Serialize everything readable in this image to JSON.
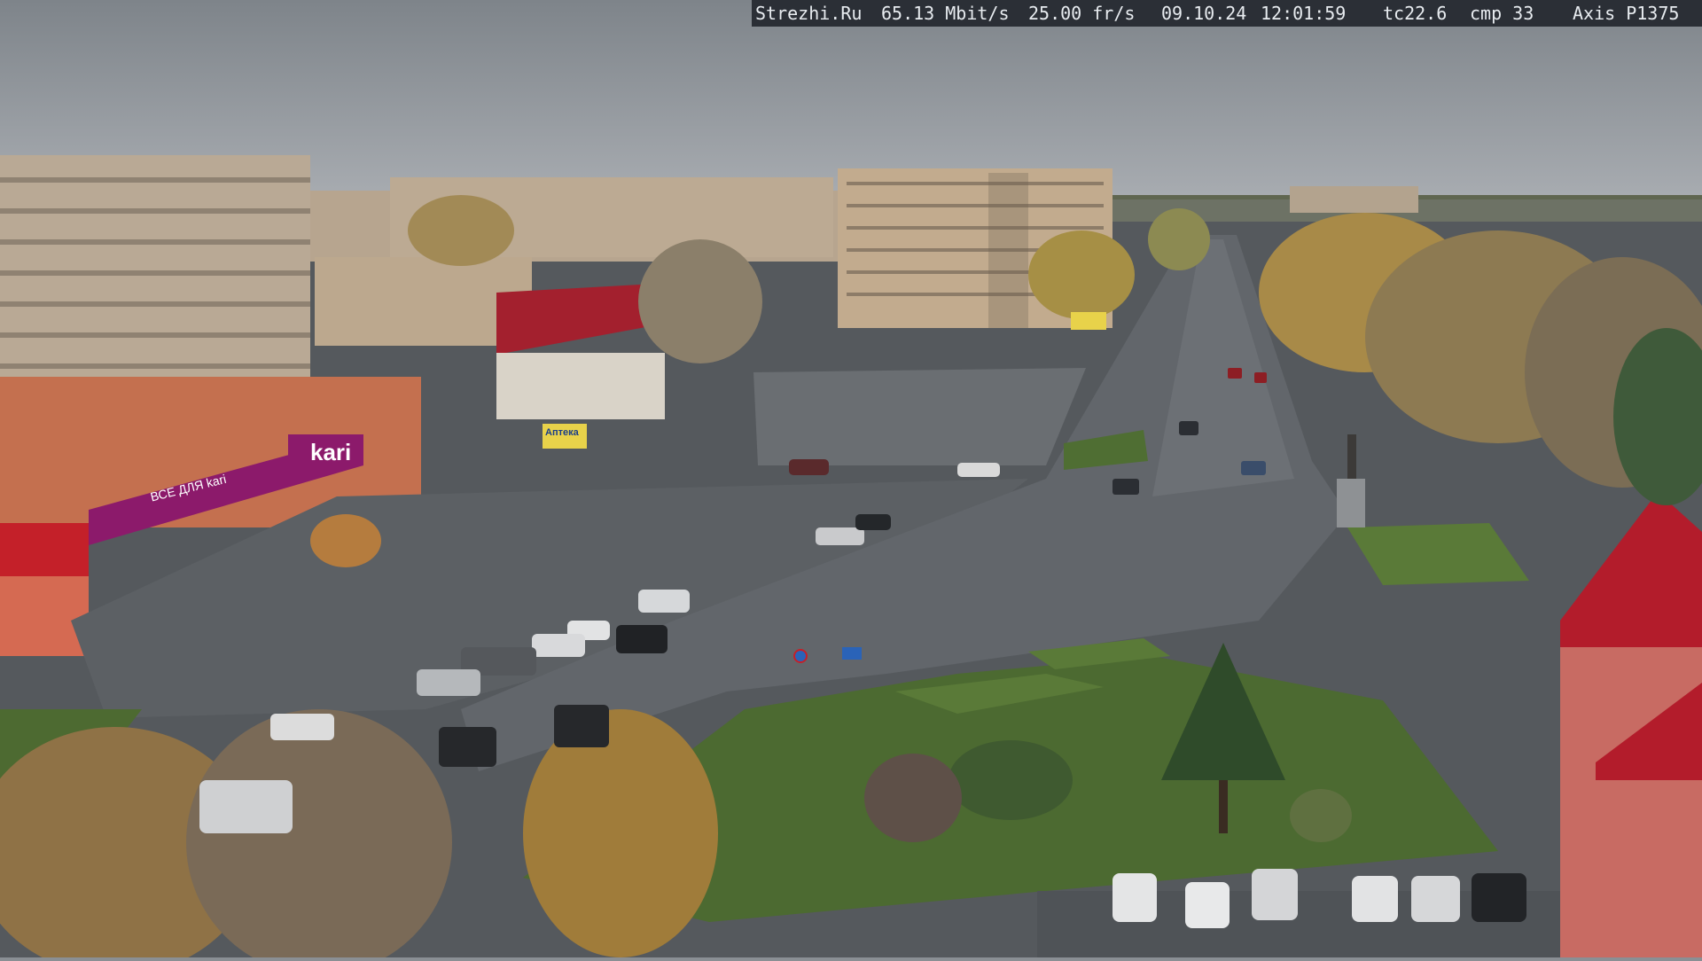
{
  "camera_overlay": {
    "site": "Strezhi.Ru",
    "bitrate": "65.13 Mbit/s",
    "framerate": "25.00 fr/s",
    "date": "09.10.24",
    "time": "12:01:59",
    "tc": "tc22.6",
    "cmp": "cmp 33",
    "camera_model": "Axis P1375"
  },
  "signs": {
    "store_brand": "kari",
    "store_tagline": "ВСЕ ДЛЯ kari",
    "pharmacy": "Аптека"
  },
  "colors": {
    "sky": "#8f949a",
    "road": "#5d6166",
    "lawn": "#4a6b2f",
    "kari_purple": "#8c1a6b",
    "red_roof": "#b01e2a",
    "foliage": "#b48d3c"
  }
}
